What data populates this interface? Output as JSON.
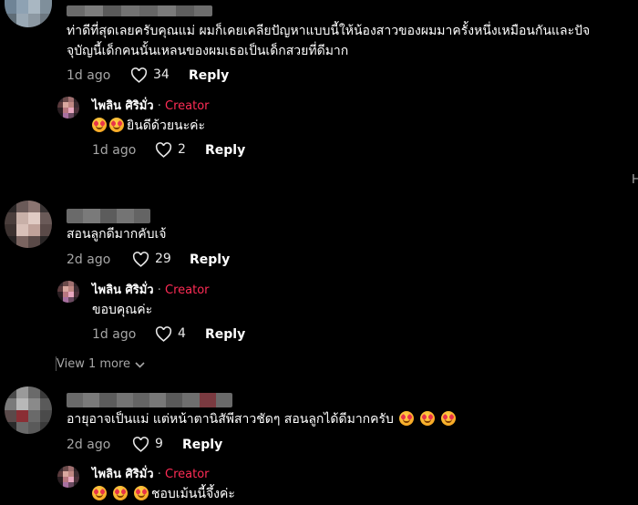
{
  "comments": [
    {
      "text_lines": [
        "ท่าดีที่สุดเลยครับคุณแม่ ผมก็เคยเคลียปัญหาแบบนี้ให้น้องสาวของผมมาครั้งหนึ่งเหมือนกันและปัจ",
        "จุบัญนี้เด็กคนนั้นเหลนของผมเธอเป็นเด็กสวยที่ดีมาก"
      ],
      "time": "1d ago",
      "likes": "34",
      "reply_label": "Reply",
      "creator_reply": {
        "name": "ไพลิน ศิริมั่ว",
        "separator": "·",
        "tag": "Creator",
        "text": "ยินดีด้วยนะค่ะ",
        "emoji_count": 2,
        "time": "1d ago",
        "likes": "2",
        "reply_label": "Reply"
      }
    },
    {
      "text_lines": [
        "สอนลูกดีมากคับเจ้"
      ],
      "time": "2d ago",
      "likes": "29",
      "reply_label": "Reply",
      "creator_reply": {
        "name": "ไพลิน ศิริมั่ว",
        "separator": "·",
        "tag": "Creator",
        "text": "ขอบคุณค่ะ",
        "emoji_count": 0,
        "time": "1d ago",
        "likes": "4",
        "reply_label": "Reply"
      },
      "view_more": "View 1 more"
    },
    {
      "text_lines": [
        "อายุอาจเป็นแม่ แต่หน้าตานิสัพีสาวชัดๆ สอนลูกได้ดีมากครับ"
      ],
      "trailing_emoji_count": 3,
      "time": "2d ago",
      "likes": "9",
      "reply_label": "Reply",
      "creator_reply": {
        "name": "ไพลิน ศิริมั่ว",
        "separator": "·",
        "tag": "Creator",
        "text": "ชอบเม้นนี้จึ้งค่ะ",
        "emoji_count": 3
      }
    }
  ],
  "edge_letter": "H",
  "colors": {
    "background": "#000000",
    "creator_tag": "#fe2c55",
    "muted": "#a6a6a6"
  },
  "icons": [
    "heart-icon",
    "chevron-down-icon",
    "emoji-heart-eyes-icon"
  ]
}
